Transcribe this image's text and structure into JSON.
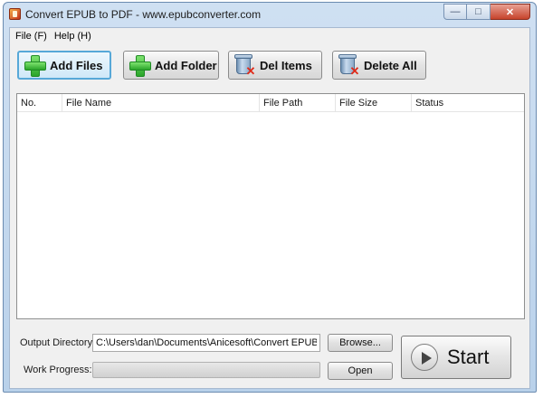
{
  "window": {
    "title": "Convert EPUB to PDF - www.epubconverter.com",
    "controls": {
      "minimize": "—",
      "maximize": "□",
      "close": "✕"
    }
  },
  "menu": [
    {
      "label": "File (F)"
    },
    {
      "label": "Help (H)"
    }
  ],
  "toolbar": {
    "add_files": {
      "label": "Add Files",
      "icon": "plus-icon"
    },
    "add_folder": {
      "label": "Add Folder",
      "icon": "plus-icon"
    },
    "del_items": {
      "label": "Del Items",
      "icon": "bin-icon"
    },
    "delete_all": {
      "label": "Delete All",
      "icon": "bin-icon"
    }
  },
  "file_list": {
    "columns": [
      "No.",
      "File Name",
      "File Path",
      "File Size",
      "Status"
    ],
    "rows": []
  },
  "output": {
    "label": "Output Directory:",
    "value": "C:\\Users\\dan\\Documents\\Anicesoft\\Convert EPUB to P",
    "browse_label": "Browse..."
  },
  "progress": {
    "label": "Work Progress:",
    "value": 0,
    "open_label": "Open"
  },
  "start": {
    "label": "Start",
    "icon": "play-icon"
  },
  "colors": {
    "titlebar": "#cfe0f2",
    "active_button_border": "#57a8d8",
    "plus_green": "#2aa52a",
    "delete_red": "#e02a18"
  }
}
